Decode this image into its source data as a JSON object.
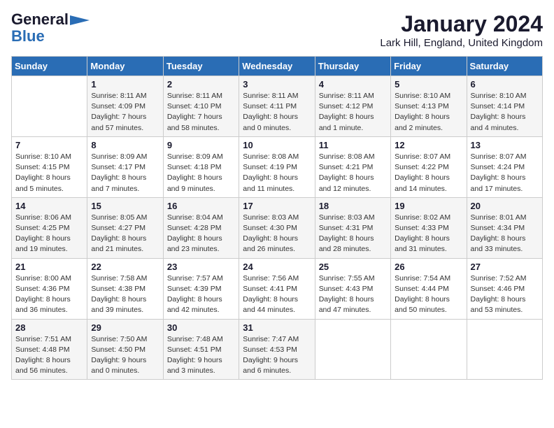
{
  "header": {
    "logo_line1": "General",
    "logo_line2": "Blue",
    "month": "January 2024",
    "location": "Lark Hill, England, United Kingdom"
  },
  "weekdays": [
    "Sunday",
    "Monday",
    "Tuesday",
    "Wednesday",
    "Thursday",
    "Friday",
    "Saturday"
  ],
  "weeks": [
    [
      {
        "num": "",
        "info": ""
      },
      {
        "num": "1",
        "info": "Sunrise: 8:11 AM\nSunset: 4:09 PM\nDaylight: 7 hours\nand 57 minutes."
      },
      {
        "num": "2",
        "info": "Sunrise: 8:11 AM\nSunset: 4:10 PM\nDaylight: 7 hours\nand 58 minutes."
      },
      {
        "num": "3",
        "info": "Sunrise: 8:11 AM\nSunset: 4:11 PM\nDaylight: 8 hours\nand 0 minutes."
      },
      {
        "num": "4",
        "info": "Sunrise: 8:11 AM\nSunset: 4:12 PM\nDaylight: 8 hours\nand 1 minute."
      },
      {
        "num": "5",
        "info": "Sunrise: 8:10 AM\nSunset: 4:13 PM\nDaylight: 8 hours\nand 2 minutes."
      },
      {
        "num": "6",
        "info": "Sunrise: 8:10 AM\nSunset: 4:14 PM\nDaylight: 8 hours\nand 4 minutes."
      }
    ],
    [
      {
        "num": "7",
        "info": "Sunrise: 8:10 AM\nSunset: 4:15 PM\nDaylight: 8 hours\nand 5 minutes."
      },
      {
        "num": "8",
        "info": "Sunrise: 8:09 AM\nSunset: 4:17 PM\nDaylight: 8 hours\nand 7 minutes."
      },
      {
        "num": "9",
        "info": "Sunrise: 8:09 AM\nSunset: 4:18 PM\nDaylight: 8 hours\nand 9 minutes."
      },
      {
        "num": "10",
        "info": "Sunrise: 8:08 AM\nSunset: 4:19 PM\nDaylight: 8 hours\nand 11 minutes."
      },
      {
        "num": "11",
        "info": "Sunrise: 8:08 AM\nSunset: 4:21 PM\nDaylight: 8 hours\nand 12 minutes."
      },
      {
        "num": "12",
        "info": "Sunrise: 8:07 AM\nSunset: 4:22 PM\nDaylight: 8 hours\nand 14 minutes."
      },
      {
        "num": "13",
        "info": "Sunrise: 8:07 AM\nSunset: 4:24 PM\nDaylight: 8 hours\nand 17 minutes."
      }
    ],
    [
      {
        "num": "14",
        "info": "Sunrise: 8:06 AM\nSunset: 4:25 PM\nDaylight: 8 hours\nand 19 minutes."
      },
      {
        "num": "15",
        "info": "Sunrise: 8:05 AM\nSunset: 4:27 PM\nDaylight: 8 hours\nand 21 minutes."
      },
      {
        "num": "16",
        "info": "Sunrise: 8:04 AM\nSunset: 4:28 PM\nDaylight: 8 hours\nand 23 minutes."
      },
      {
        "num": "17",
        "info": "Sunrise: 8:03 AM\nSunset: 4:30 PM\nDaylight: 8 hours\nand 26 minutes."
      },
      {
        "num": "18",
        "info": "Sunrise: 8:03 AM\nSunset: 4:31 PM\nDaylight: 8 hours\nand 28 minutes."
      },
      {
        "num": "19",
        "info": "Sunrise: 8:02 AM\nSunset: 4:33 PM\nDaylight: 8 hours\nand 31 minutes."
      },
      {
        "num": "20",
        "info": "Sunrise: 8:01 AM\nSunset: 4:34 PM\nDaylight: 8 hours\nand 33 minutes."
      }
    ],
    [
      {
        "num": "21",
        "info": "Sunrise: 8:00 AM\nSunset: 4:36 PM\nDaylight: 8 hours\nand 36 minutes."
      },
      {
        "num": "22",
        "info": "Sunrise: 7:58 AM\nSunset: 4:38 PM\nDaylight: 8 hours\nand 39 minutes."
      },
      {
        "num": "23",
        "info": "Sunrise: 7:57 AM\nSunset: 4:39 PM\nDaylight: 8 hours\nand 42 minutes."
      },
      {
        "num": "24",
        "info": "Sunrise: 7:56 AM\nSunset: 4:41 PM\nDaylight: 8 hours\nand 44 minutes."
      },
      {
        "num": "25",
        "info": "Sunrise: 7:55 AM\nSunset: 4:43 PM\nDaylight: 8 hours\nand 47 minutes."
      },
      {
        "num": "26",
        "info": "Sunrise: 7:54 AM\nSunset: 4:44 PM\nDaylight: 8 hours\nand 50 minutes."
      },
      {
        "num": "27",
        "info": "Sunrise: 7:52 AM\nSunset: 4:46 PM\nDaylight: 8 hours\nand 53 minutes."
      }
    ],
    [
      {
        "num": "28",
        "info": "Sunrise: 7:51 AM\nSunset: 4:48 PM\nDaylight: 8 hours\nand 56 minutes."
      },
      {
        "num": "29",
        "info": "Sunrise: 7:50 AM\nSunset: 4:50 PM\nDaylight: 9 hours\nand 0 minutes."
      },
      {
        "num": "30",
        "info": "Sunrise: 7:48 AM\nSunset: 4:51 PM\nDaylight: 9 hours\nand 3 minutes."
      },
      {
        "num": "31",
        "info": "Sunrise: 7:47 AM\nSunset: 4:53 PM\nDaylight: 9 hours\nand 6 minutes."
      },
      {
        "num": "",
        "info": ""
      },
      {
        "num": "",
        "info": ""
      },
      {
        "num": "",
        "info": ""
      }
    ]
  ]
}
